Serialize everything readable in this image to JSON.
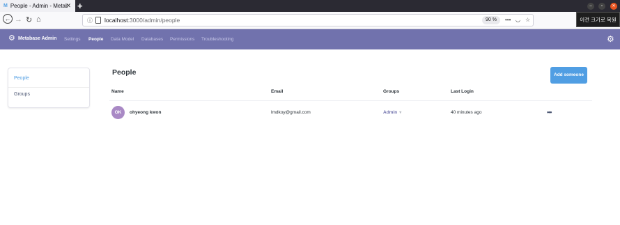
{
  "browser": {
    "tab_title": "People - Admin - Metaba",
    "tab_favicon": "M",
    "url_host": "localhost",
    "url_path": ":3000/admin/people",
    "zoom": "90 %",
    "tooltip": "이전 크기로 복원"
  },
  "admin_nav": {
    "brand": "Metabase Admin",
    "items": [
      "Settings",
      "People",
      "Data Model",
      "Databases",
      "Permissions",
      "Troubleshooting"
    ],
    "active": "People"
  },
  "sidebar": {
    "items": [
      {
        "label": "People",
        "selected": true
      },
      {
        "label": "Groups",
        "selected": false
      }
    ]
  },
  "main": {
    "title": "People",
    "add_button": "Add someone",
    "columns": [
      "Name",
      "Email",
      "Groups",
      "Last Login"
    ],
    "rows": [
      {
        "initials": "OK",
        "name": "ohyeong kwon",
        "email": "lmdkoy@gmail.com",
        "group": "Admin",
        "last_login": "40 minutes ago"
      }
    ]
  },
  "colors": {
    "admin_header": "#7172ad",
    "accent": "#509ee3",
    "avatar": "#a989c5"
  }
}
